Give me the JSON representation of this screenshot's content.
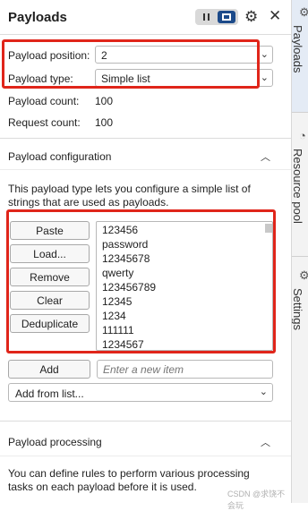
{
  "header": {
    "title": "Payloads"
  },
  "payload_sets": {
    "position_label": "Payload position:",
    "position_value": "2",
    "type_label": "Payload type:",
    "type_value": "Simple list",
    "count_label": "Payload count:",
    "count_value": "100",
    "request_label": "Request count:",
    "request_value": "100"
  },
  "config": {
    "title": "Payload configuration",
    "description": "This payload type lets you configure a simple list of strings that are used as payloads.",
    "buttons": {
      "paste": "Paste",
      "load": "Load...",
      "remove": "Remove",
      "clear": "Clear",
      "dedup": "Deduplicate"
    },
    "items": [
      "123456",
      "password",
      "12345678",
      "qwerty",
      "123456789",
      "12345",
      "1234",
      "111111",
      "1234567"
    ],
    "add_label": "Add",
    "add_placeholder": "Enter a new item",
    "add_from_list": "Add from list..."
  },
  "processing": {
    "title": "Payload processing",
    "description": "You can define rules to perform various processing tasks on each payload before it is used."
  },
  "side_tabs": {
    "payloads": "Payloads",
    "resource_pool": "Resource pool",
    "settings": "Settings"
  },
  "watermark": "CSDN @求饶不会玩",
  "colors": {
    "highlight": "#e0251a",
    "toggle_active": "#1c4a8a"
  }
}
